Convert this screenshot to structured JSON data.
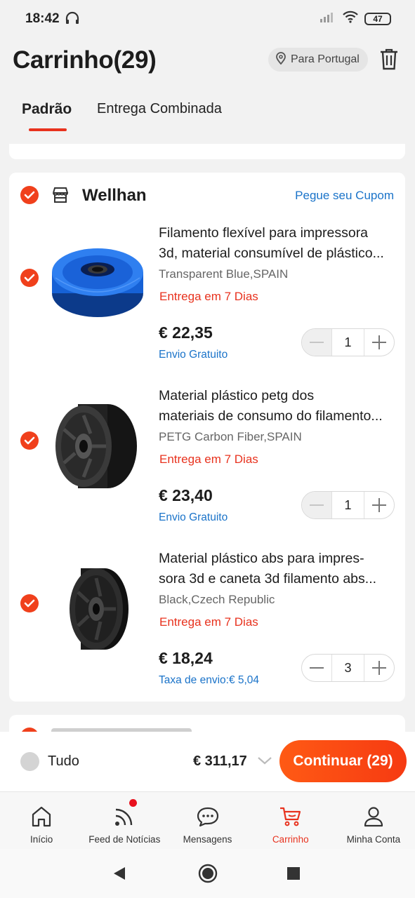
{
  "status_bar": {
    "time": "18:42",
    "battery": "47"
  },
  "header": {
    "title": "Carrinho(29)",
    "location": "Para Portugal"
  },
  "tabs": [
    {
      "label": "Padrão",
      "active": true
    },
    {
      "label": "Entrega Combinada",
      "active": false
    }
  ],
  "store": {
    "name": "Wellhan",
    "coupon_link": "Pegue seu Cupom",
    "items": [
      {
        "title_line1": "Filamento flexível para impressora",
        "title_line2": "3d, material consumível de plástico...",
        "variant": "Transparent Blue,SPAIN",
        "delivery": "Entrega em 7 Dias",
        "price": "€ 22,35",
        "shipping": "Envio Gratuito",
        "quantity": "1",
        "image_color": "#1e6fd9"
      },
      {
        "title_line1": "Material plástico petg dos",
        "title_line2": "materiais de consumo do filamento...",
        "variant": "PETG Carbon Fiber,SPAIN",
        "delivery": "Entrega em 7 Dias",
        "price": "€ 23,40",
        "shipping": "Envio Gratuito",
        "quantity": "1",
        "image_color": "#2a2a2a"
      },
      {
        "title_line1": "Material plástico abs para impres-",
        "title_line2": "sora 3d e caneta 3d filamento abs...",
        "variant": "Black,Czech Republic",
        "delivery": "Entrega em 7 Dias",
        "price": "€ 18,24",
        "shipping": "Taxa de envio:€ 5,04",
        "quantity": "3",
        "image_color": "#1a1a1a"
      }
    ]
  },
  "checkout": {
    "select_all_label": "Tudo",
    "total": "€ 311,17",
    "continue_label": "Continuar (29)"
  },
  "bottom_nav": [
    {
      "label": "Início",
      "icon": "home-icon"
    },
    {
      "label": "Feed de Notícias",
      "icon": "feed-icon"
    },
    {
      "label": "Mensagens",
      "icon": "messages-icon"
    },
    {
      "label": "Carrinho",
      "icon": "cart-icon",
      "active": true
    },
    {
      "label": "Minha Conta",
      "icon": "account-icon"
    }
  ],
  "colors": {
    "accent": "#e8321e",
    "link": "#1a73c9",
    "check": "#f0401c"
  }
}
